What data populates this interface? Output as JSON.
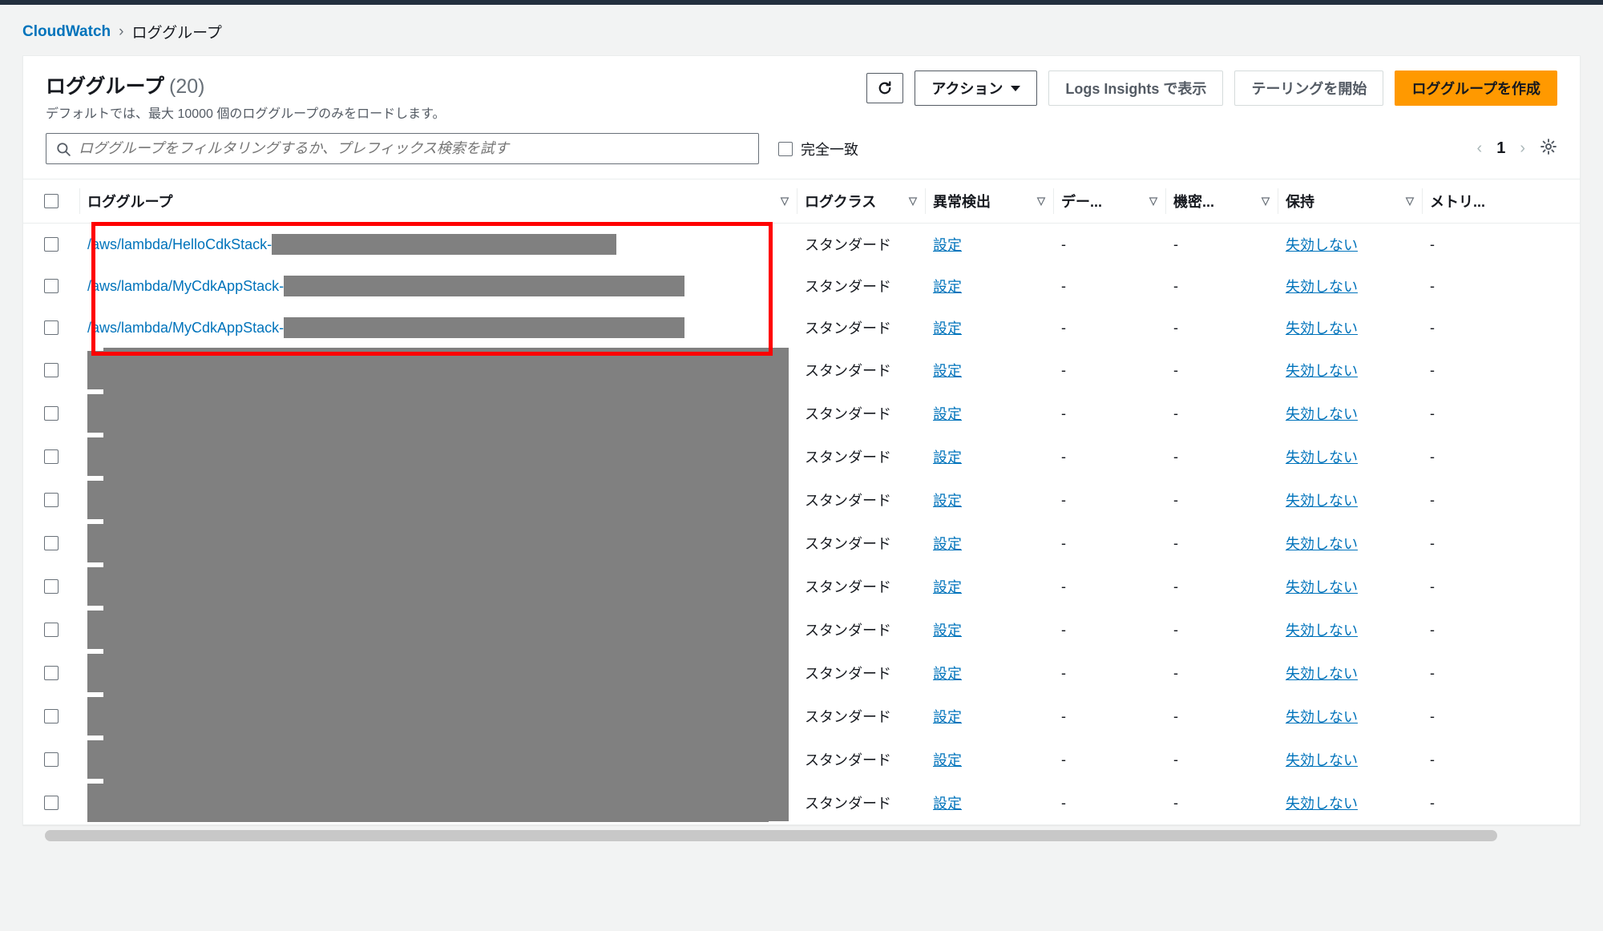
{
  "breadcrumb": {
    "root": "CloudWatch",
    "current": "ロググループ"
  },
  "header": {
    "title": "ロググループ",
    "count": "(20)",
    "subtitle": "デフォルトでは、最大 10000 個のロググループのみをロードします。",
    "actions": {
      "refresh_title": "更新",
      "actions_label": "アクション",
      "insights_label": "Logs Insights で表示",
      "tailing_label": "テーリングを開始",
      "create_label": "ロググループを作成"
    }
  },
  "filter": {
    "placeholder": "ロググループをフィルタリングするか、プレフィックス検索を試す",
    "exact_match_label": "完全一致"
  },
  "pager": {
    "page": "1"
  },
  "columns": {
    "name": "ロググループ",
    "class": "ログクラス",
    "anomaly": "異常検出",
    "data": "デー...",
    "secret": "機密...",
    "retention": "保持",
    "metrics": "メトリ..."
  },
  "values": {
    "standard": "スタンダード",
    "settings": "設定",
    "no_expire": "失効しない",
    "dash": "-"
  },
  "rows": [
    {
      "name": "/aws/lambda/HelloCdkStack-",
      "redact_w": 430,
      "highlighted": true
    },
    {
      "name": "/aws/lambda/MyCdkAppStack-",
      "redact_w": 500,
      "highlighted": true
    },
    {
      "name": "/aws/lambda/MyCdkAppStack-",
      "redact_w": 500,
      "highlighted": true
    },
    {
      "name": "",
      "full_redact": true
    },
    {
      "name": "",
      "full_redact": true
    },
    {
      "name": "",
      "full_redact": true
    },
    {
      "name": "",
      "full_redact": true
    },
    {
      "name": "",
      "full_redact": true
    },
    {
      "name": "",
      "full_redact": true
    },
    {
      "name": "",
      "full_redact": true
    },
    {
      "name": "",
      "full_redact": true
    },
    {
      "name": "",
      "full_redact": true
    },
    {
      "name": "",
      "full_redact": true
    },
    {
      "name": "",
      "full_redact": true
    }
  ]
}
